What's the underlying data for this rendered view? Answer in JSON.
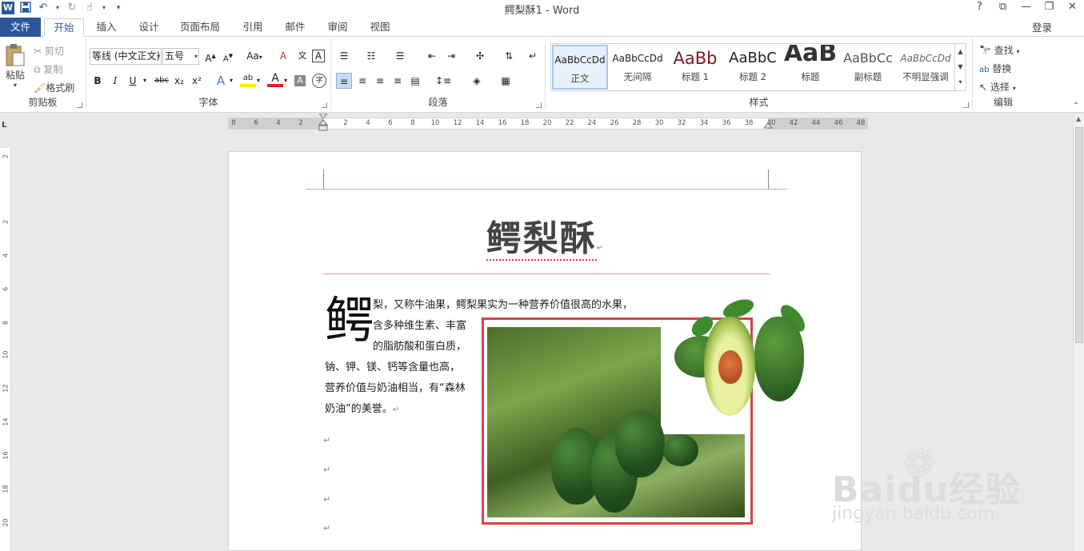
{
  "app": {
    "title": "鳄梨酥1 - Word",
    "help": "?",
    "restore_ribbon": "⧉",
    "minimize": "—",
    "maximize": "❐",
    "close": "✕"
  },
  "qat": {
    "logo": "W",
    "save_icon": "save-icon",
    "undo_icon": "undo-icon",
    "redo_icon": "redo-icon",
    "touch_icon": "touch-mode-icon",
    "customize": "▾"
  },
  "tabs": [
    "文件",
    "开始",
    "插入",
    "设计",
    "页面布局",
    "引用",
    "邮件",
    "审阅",
    "视图"
  ],
  "active_tab": "开始",
  "login": "登录",
  "clipboard": {
    "paste": "粘贴",
    "cut": "剪切",
    "copy": "复制",
    "format_painter": "格式刷",
    "label": "剪贴板"
  },
  "font": {
    "name": "等线 (中文正文)",
    "size": "五号",
    "grow": "A",
    "shrink": "A",
    "case": "Aa",
    "clear": "A",
    "phonetic": "文",
    "border": "A",
    "bold": "B",
    "italic": "I",
    "underline": "U",
    "strike": "abc",
    "sub": "x₂",
    "sup": "x²",
    "effects": "A",
    "highlight": "ab",
    "color": "A",
    "shade": "A",
    "enclose": "字",
    "label": "字体"
  },
  "paragraph": {
    "label": "段落"
  },
  "styles": {
    "label": "样式",
    "items": [
      {
        "sample": "AaBbCcDd",
        "name": "正文"
      },
      {
        "sample": "AaBbCcDd",
        "name": "无间隔"
      },
      {
        "sample": "AaBb",
        "name": "标题 1"
      },
      {
        "sample": "AaBbC",
        "name": "标题 2"
      },
      {
        "sample": "AaB",
        "name": "标题"
      },
      {
        "sample": "AaBbCc",
        "name": "副标题"
      },
      {
        "sample": "AaBbCcDd",
        "name": "不明显强调"
      }
    ]
  },
  "editing": {
    "find": "查找",
    "replace": "替换",
    "select": "选择",
    "label": "编辑"
  },
  "ruler": {
    "left_marks": [
      "8",
      "6",
      "4",
      "2"
    ],
    "right_marks": [
      "2",
      "4",
      "6",
      "8",
      "10",
      "12",
      "14",
      "16",
      "18",
      "20",
      "22",
      "24",
      "26",
      "28",
      "30",
      "32",
      "34",
      "36",
      "38",
      "40",
      "42",
      "44",
      "46",
      "48"
    ],
    "tab_selector": "L"
  },
  "vruler": {
    "marks": [
      "2",
      "2",
      "4",
      "6",
      "8",
      "10",
      "12",
      "14",
      "16",
      "18",
      "20"
    ]
  },
  "document": {
    "title": "鳄梨酥",
    "dropcap": "鳄",
    "lines": [
      "梨，又称牛油果，鳄梨果实为一种营养价值很高的水果，",
      "含多种维生素、丰富",
      "的脂肪酸和蛋白质，",
      "钠、钾、镁、钙等含量也高，",
      "营养价值与奶油相当，有“森林",
      "奶油”的美誉。"
    ],
    "para_mark": "↵"
  },
  "watermark": {
    "brand": "Baidu经验",
    "url": "jingyan.baidu.com"
  }
}
